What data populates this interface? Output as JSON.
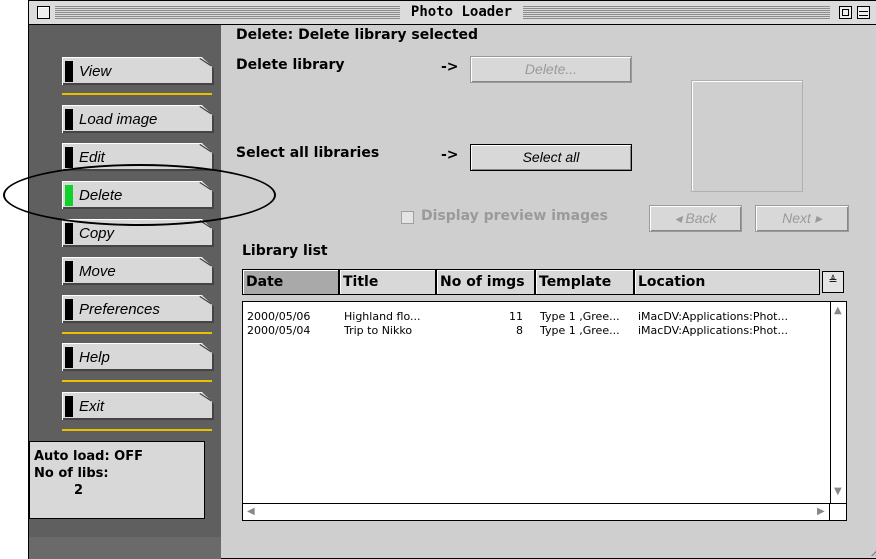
{
  "window": {
    "title": "Photo Loader"
  },
  "sidebar": {
    "items": [
      {
        "label": "View"
      },
      {
        "label": "Load image"
      },
      {
        "label": "Edit"
      },
      {
        "label": "Delete"
      },
      {
        "label": "Copy"
      },
      {
        "label": "Move"
      },
      {
        "label": "Preferences"
      },
      {
        "label": "Help"
      },
      {
        "label": "Exit"
      }
    ],
    "active_item": "Delete",
    "status": {
      "auto_load": "Auto load: OFF",
      "libs_label": "No of libs:",
      "libs_count": "2"
    }
  },
  "main": {
    "heading": "Delete: Delete library selected",
    "delete_library_label": "Delete library",
    "select_all_label": "Select all libraries",
    "arrow": "->",
    "delete_button": "Delete...",
    "select_all_button": "Select all",
    "display_preview_label": "Display preview images",
    "display_preview_checked": false,
    "back_button": "Back",
    "next_button": "Next",
    "library_list_label": "Library list"
  },
  "library_list": {
    "columns": [
      "Date",
      "Title",
      "No of imgs",
      "Template",
      "Location"
    ],
    "sorted_column": "Date",
    "rows": [
      {
        "date": "2000/05/06",
        "title": "Highland flo...",
        "count": "11",
        "template": "Type 1 ,Gree...",
        "location": "iMacDV:Applications:Phot..."
      },
      {
        "date": "2000/05/04",
        "title": "Trip to Nikko",
        "count": "8",
        "template": "Type 1 ,Gree...",
        "location": "iMacDV:Applications:Phot..."
      }
    ]
  },
  "colors": {
    "active_tab": "#10d02a",
    "separator": "#e8c000",
    "sidebar_bg": "#5f5f5f"
  }
}
